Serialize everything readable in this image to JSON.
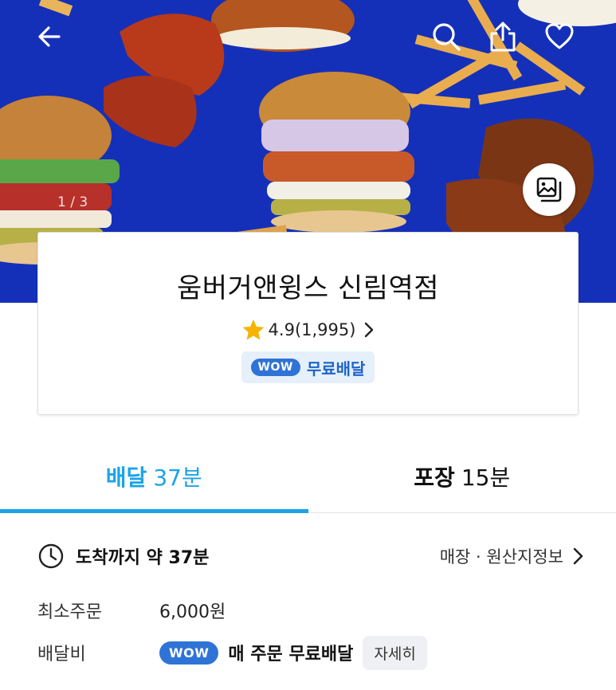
{
  "hero": {
    "counter": "1 / 3",
    "icons": {
      "back": "arrow-left-icon",
      "search": "search-icon",
      "share": "share-icon",
      "favorite": "heart-icon",
      "gallery": "gallery-icon"
    },
    "background_color": "#1530b8"
  },
  "store": {
    "name": "움버거앤윙스 신림역점",
    "rating": "4.9(1,995)",
    "wow_badge": "WOW",
    "free_delivery": "무료배달"
  },
  "tabs": [
    {
      "label": "배달",
      "time": "37분",
      "active": true
    },
    {
      "label": "포장",
      "time": "15분",
      "active": false
    }
  ],
  "info": {
    "arrival_label": "도착까지 약 37분",
    "store_info_link": "매장 · 원산지정보",
    "min_order_label": "최소주문",
    "min_order_value": "6,000원",
    "delivery_fee_label": "배달비",
    "fee_badge": "WOW",
    "fee_text": "매 주문 무료배달",
    "detail_button": "자세히"
  },
  "colors": {
    "accent": "#1aa3e8",
    "wow_blue": "#2f73d6",
    "star": "#f5b400"
  }
}
